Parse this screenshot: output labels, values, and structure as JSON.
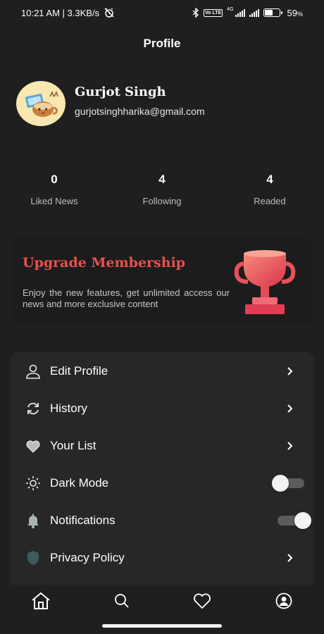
{
  "status_bar": {
    "time_net": "10:21 AM | 3.3KB/s",
    "volte": "Vo LTE",
    "net_type": "4G",
    "battery": "59",
    "battery_unit": "%",
    "battery_level": 0.59
  },
  "header": {
    "title": "Profile"
  },
  "profile": {
    "name": "Gurjot Singh",
    "email": "gurjotsinghharika@gmail.com"
  },
  "stats": [
    {
      "value": "0",
      "label": "Liked News"
    },
    {
      "value": "4",
      "label": "Following"
    },
    {
      "value": "4",
      "label": "Readed"
    }
  ],
  "upgrade": {
    "title": "Upgrade Membership",
    "description": "Enjoy the new features, get unlimited access our news and more exclusive content",
    "icon": "trophy-icon",
    "color": "#e8514d"
  },
  "menu": {
    "items": [
      {
        "label": "Edit Profile",
        "icon": "user-icon",
        "control": "chevron"
      },
      {
        "label": "History",
        "icon": "refresh-icon",
        "control": "chevron"
      },
      {
        "label": "Your List",
        "icon": "heart-icon",
        "control": "chevron"
      },
      {
        "label": "Dark Mode",
        "icon": "sun-icon",
        "control": "toggle",
        "toggle_on": false
      },
      {
        "label": "Notifications",
        "icon": "bell-icon",
        "control": "toggle",
        "toggle_on": true
      },
      {
        "label": "Privacy Policy",
        "icon": "shield-icon",
        "control": "chevron"
      }
    ]
  },
  "bottom_nav": [
    "home-icon",
    "search-icon",
    "heart-icon",
    "profile-icon"
  ]
}
